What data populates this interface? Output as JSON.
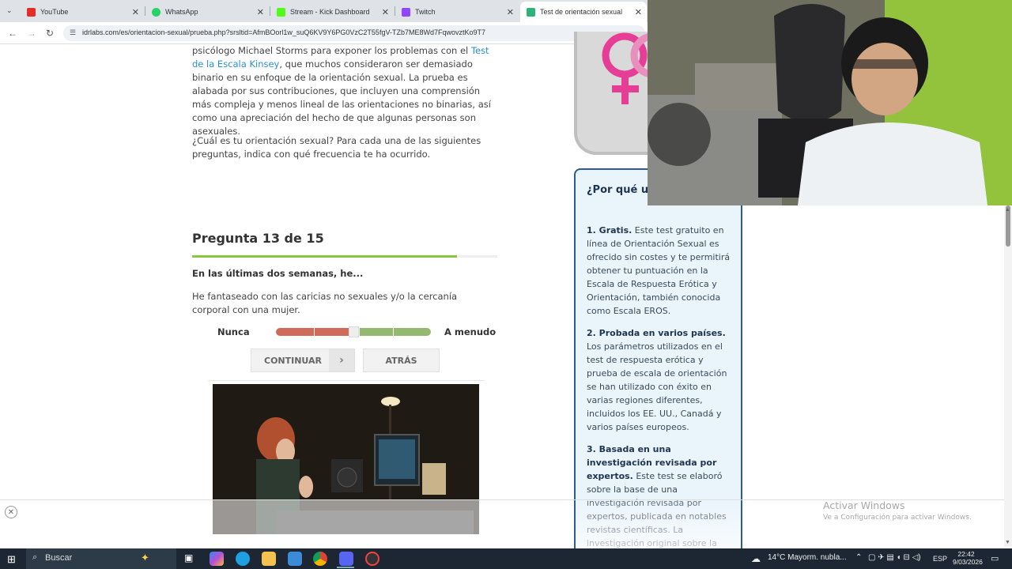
{
  "tabs": [
    {
      "label": "YouTube",
      "color": "#e52d27"
    },
    {
      "label": "WhatsApp",
      "color": "#25d366"
    },
    {
      "label": "Stream - Kick Dashboard",
      "color": "#53fc18"
    },
    {
      "label": "Twitch",
      "color": "#9146ff"
    },
    {
      "label": "Test de orientación sexual",
      "color": "#2db37a"
    }
  ],
  "url": "idrlabs.com/es/orientacion-sexual/prueba.php?srsltid=AfmBOorl1w_suQ6KV9Y6PG0VzC2T55fgV-TZb7ME8Wd7FqwovztKo9T7",
  "article": {
    "p1_a": "psicólogo Michael Storms para exponer los problemas con el ",
    "p1_link": "Test de la Escala Kinsey",
    "p1_b": ", que muchos consideraron ser demasiado binario en su enfoque de la orientación sexual. La prueba es alabada por sus contribuciones, que incluyen una comprensión más compleja y menos lineal de las orientaciones no binarias, así como una apreciación del hecho de que algunas personas son asexuales.",
    "p2": "¿Cuál es tu orientación sexual? Para cada una de las siguientes preguntas, indica con qué frecuencia te ha ocurrido."
  },
  "question": {
    "title": "Pregunta 13 de 15",
    "progress": 0.867,
    "subtitle": "En las últimas dos semanas, he...",
    "text": "He fantaseado con las caricias no sexuales y/o la cercanía corporal con una mujer.",
    "scale_min": "Nunca",
    "scale_max": "A menudo",
    "continue_label": "CONTINUAR",
    "back_label": "ATRÁS"
  },
  "panel": {
    "title": "¿Por qué us prueba?",
    "items": [
      {
        "head": "1. Gratis.",
        "body": " Este test gratuito en línea de Orientación Sexual es ofrecido sin costes y te permitirá obtener tu puntuación en la Escala de Respuesta Erótica y Orientación, también conocida como Escala EROS."
      },
      {
        "head": "2. Probada en varios países.",
        "body": " Los parámetros utilizados en el test de respuesta erótica y prueba de escala de orientación se han utilizado con éxito en varias regiones diferentes, incluidos los EE. UU., Canadá y varios países europeos."
      },
      {
        "head": "3. Basada en una investigación revisada por expertos.",
        "body": " Este test se elaboró sobre la base de una investigación revisada por expertos, publicada en notables revistas científicas. La investigación original sobre la escala EROS se publicó en la"
      }
    ]
  },
  "activate": {
    "title": "Activar Windows",
    "subtitle": "Ve a Configuración para activar Windows."
  },
  "taskbar": {
    "search": "Buscar",
    "weather": "14°C  Mayorm. nubla...",
    "lang": "ESP",
    "time": "22:42",
    "date": "9/03/2026"
  }
}
